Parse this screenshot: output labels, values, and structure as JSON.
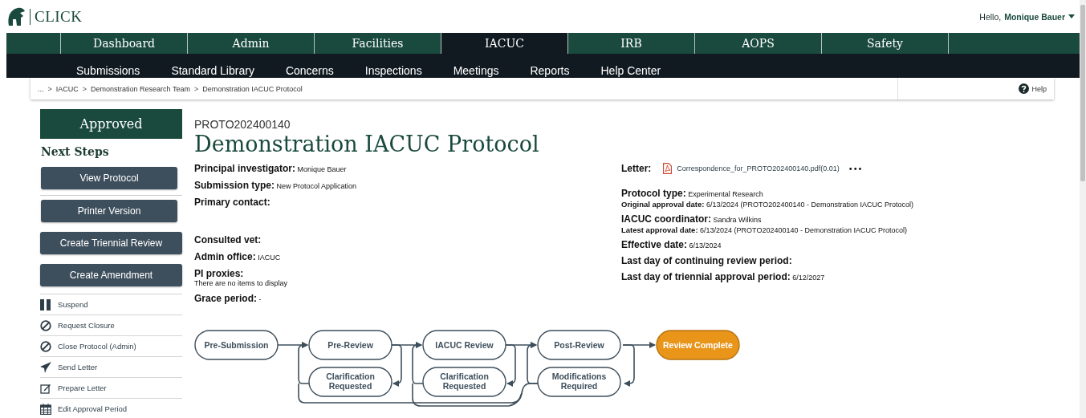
{
  "header": {
    "logo_text": "CLICK",
    "greeting": "Hello, **Monique Bauer**"
  },
  "nav": [
    {
      "label": "Dashboard",
      "selected": false
    },
    {
      "label": "Admin",
      "selected": false
    },
    {
      "label": "Facilities",
      "selected": false
    },
    {
      "label": "IACUC",
      "selected": true
    },
    {
      "label": "IRB",
      "selected": false
    },
    {
      "label": "AOPS",
      "selected": false
    },
    {
      "label": "Safety",
      "selected": false
    }
  ],
  "subnav": [
    "Submissions",
    "Standard Library",
    "Concerns",
    "Inspections",
    "Meetings",
    "Reports",
    "Help Center"
  ],
  "breadcrumb": {
    "separator": ">",
    "items": [
      "...",
      "IACUC",
      "Demonstration Research Team",
      "Demonstration IACUC Protocol"
    ]
  },
  "help": "Help",
  "sidebar": {
    "status": "Approved",
    "heading": "Next Steps",
    "buttons": [
      "View Protocol",
      "Printer Version",
      "Create Triennial Review",
      "Create Amendment"
    ],
    "actions": [
      "Suspend",
      "Request Closure",
      "Close Protocol (Admin)",
      "Send Letter",
      "Prepare Letter",
      "Edit Approval Period"
    ]
  },
  "protocol": {
    "id": "PROTO202400140",
    "title": "Demonstration IACUC Protocol"
  },
  "left_fields": [
    {
      "label": "Principal investigator:",
      "value": "Monique  Bauer",
      "kind": "inline"
    },
    {
      "label": "Submission type:",
      "value": "New Protocol Application",
      "kind": "inline"
    },
    {
      "label": "Primary contact:",
      "kind": "stacked"
    },
    {
      "label": "Consulted vet:",
      "kind": "inline"
    },
    {
      "label": "Admin office:",
      "value": "IACUC",
      "kind": "inline"
    },
    {
      "label": "PI proxies:",
      "value": "There are no items to display",
      "kind": "stacked"
    },
    {
      "label": "Grace period:",
      "value": "-",
      "kind": "inline"
    }
  ],
  "letter": {
    "label": "Letter:",
    "file": "Correspondence_for_PROTO202400140.pdf(0.01)",
    "more": "•••"
  },
  "right_fields": [
    {
      "label": "Protocol type:",
      "value": "Experimental Research",
      "kind": "inline"
    },
    {
      "label": "Original approval date:",
      "value": "6/13/2024 (PROTO202400140 - Demonstration IACUC Protocol)",
      "kind": "small"
    },
    {
      "label": "IACUC coordinator:",
      "value": "Sandra Wilkins",
      "kind": "inline"
    },
    {
      "label": "Latest approval date:",
      "value": "6/13/2024 (PROTO202400140 - Demonstration IACUC Protocol)",
      "kind": "small"
    },
    {
      "label": "Effective date:",
      "value": "6/13/2024",
      "kind": "inline"
    },
    {
      "label": "Last day of continuing review period:",
      "kind": "inline"
    },
    {
      "label": "Last day of triennial approval period:",
      "value": "6/12/2027",
      "kind": "inline"
    }
  ],
  "workflow": [
    {
      "label": "Pre-Submission",
      "current": false
    },
    {
      "label": "Pre-Review",
      "current": false
    },
    {
      "label": "Clarification Requested",
      "current": false
    },
    {
      "label": "IACUC Review",
      "current": false
    },
    {
      "label": "Clarification Requested",
      "current": false
    },
    {
      "label": "Post-Review",
      "current": false
    },
    {
      "label": "Modifications Required",
      "current": false
    },
    {
      "label": "Review Complete",
      "current": true
    }
  ]
}
